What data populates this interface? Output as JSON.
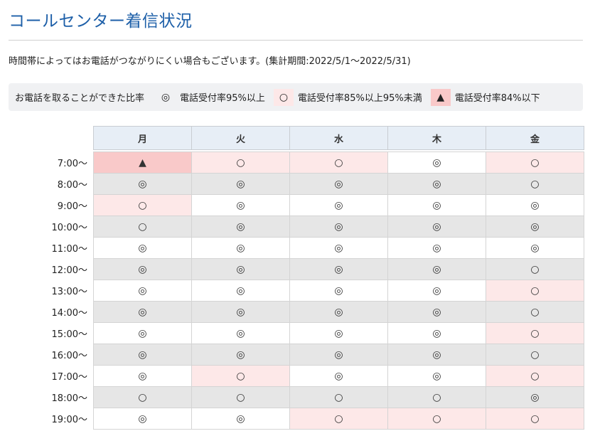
{
  "header": {
    "title": "コールセンター着信状況",
    "note": "時間帯によってはお電話がつながりにくい場合もございます。(集計期間:2022/5/1〜2022/5/31)"
  },
  "legend": {
    "lead": "お電話を取ることができた比率",
    "items": [
      {
        "symbol": "◎",
        "level": "good",
        "text": "電話受付率95%以上"
      },
      {
        "symbol": "○",
        "level": "mid",
        "text": "電話受付率85%以上95%未満"
      },
      {
        "symbol": "▲",
        "level": "low",
        "text": "電話受付率84%以下"
      }
    ]
  },
  "colors": {
    "title": "#1d5fa8",
    "header_bg": "#e7eef6",
    "mid_bg": "#fde8e8",
    "low_bg": "#f9c9c9",
    "alt_row_bg": "#e6e6e6"
  },
  "table": {
    "days": [
      "月",
      "火",
      "水",
      "木",
      "金"
    ],
    "rows": [
      {
        "time": "7:00〜",
        "cells": [
          "▲",
          "○",
          "○",
          "◎",
          "○"
        ]
      },
      {
        "time": "8:00〜",
        "cells": [
          "◎",
          "◎",
          "◎",
          "◎",
          "○"
        ]
      },
      {
        "time": "9:00〜",
        "cells": [
          "○",
          "◎",
          "◎",
          "◎",
          "◎"
        ]
      },
      {
        "time": "10:00〜",
        "cells": [
          "○",
          "◎",
          "◎",
          "◎",
          "◎"
        ]
      },
      {
        "time": "11:00〜",
        "cells": [
          "◎",
          "◎",
          "◎",
          "◎",
          "◎"
        ]
      },
      {
        "time": "12:00〜",
        "cells": [
          "◎",
          "◎",
          "◎",
          "◎",
          "○"
        ]
      },
      {
        "time": "13:00〜",
        "cells": [
          "◎",
          "◎",
          "◎",
          "◎",
          "○"
        ]
      },
      {
        "time": "14:00〜",
        "cells": [
          "◎",
          "◎",
          "◎",
          "◎",
          "○"
        ]
      },
      {
        "time": "15:00〜",
        "cells": [
          "◎",
          "◎",
          "◎",
          "◎",
          "○"
        ]
      },
      {
        "time": "16:00〜",
        "cells": [
          "◎",
          "◎",
          "◎",
          "◎",
          "○"
        ]
      },
      {
        "time": "17:00〜",
        "cells": [
          "◎",
          "○",
          "◎",
          "◎",
          "○"
        ]
      },
      {
        "time": "18:00〜",
        "cells": [
          "○",
          "○",
          "○",
          "○",
          "◎"
        ]
      },
      {
        "time": "19:00〜",
        "cells": [
          "◎",
          "◎",
          "○",
          "○",
          "○"
        ]
      }
    ]
  }
}
